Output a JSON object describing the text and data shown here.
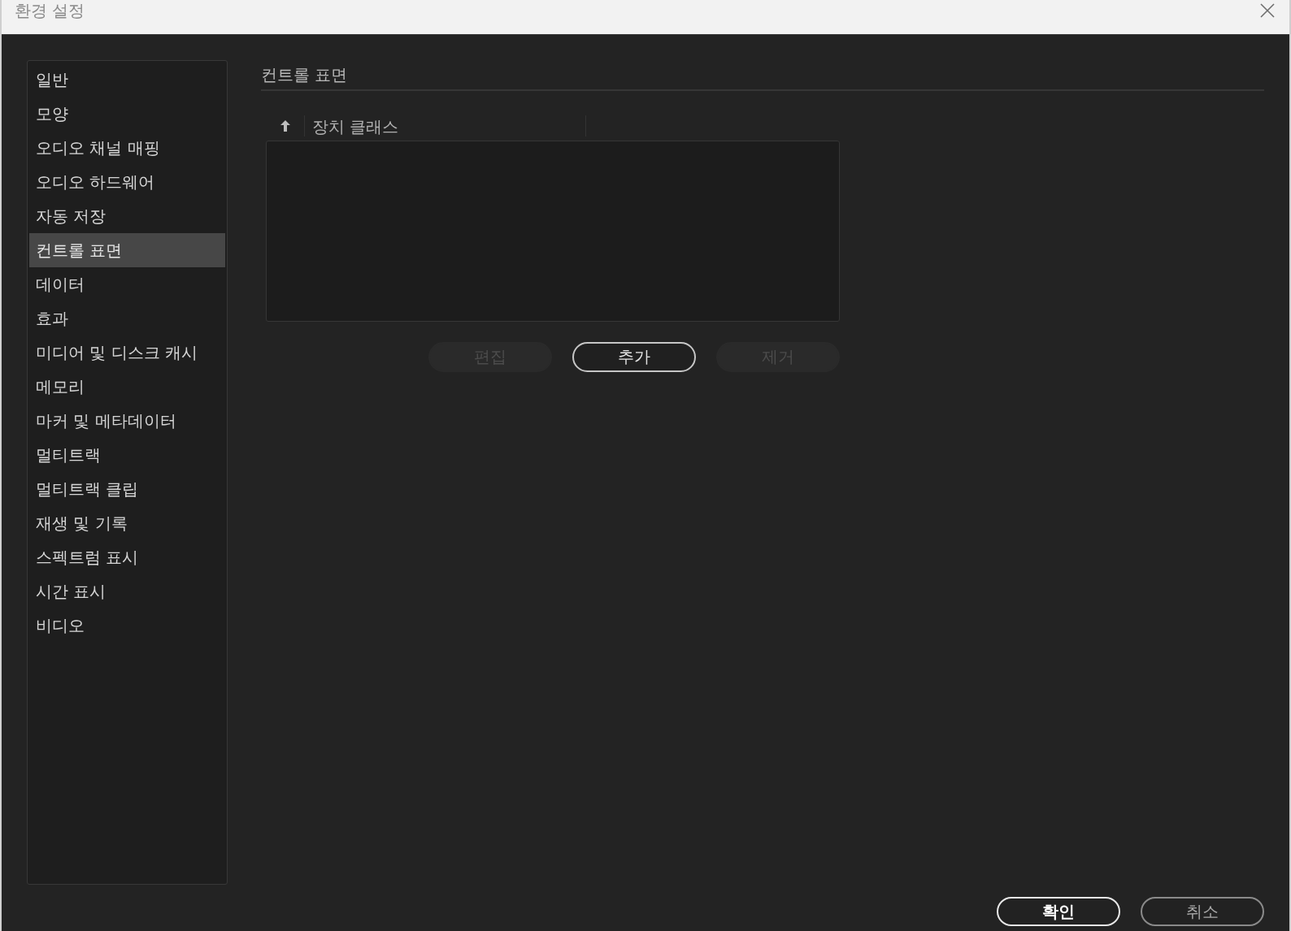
{
  "window": {
    "title": "환경 설정"
  },
  "sidebar": {
    "items": [
      {
        "label": "일반",
        "selected": false
      },
      {
        "label": "모양",
        "selected": false
      },
      {
        "label": "오디오 채널 매핑",
        "selected": false
      },
      {
        "label": "오디오 하드웨어",
        "selected": false
      },
      {
        "label": "자동 저장",
        "selected": false
      },
      {
        "label": "컨트롤 표면",
        "selected": true
      },
      {
        "label": "데이터",
        "selected": false
      },
      {
        "label": "효과",
        "selected": false
      },
      {
        "label": "미디어 및 디스크 캐시",
        "selected": false
      },
      {
        "label": "메모리",
        "selected": false
      },
      {
        "label": "마커 및 메타데이터",
        "selected": false
      },
      {
        "label": "멀티트랙",
        "selected": false
      },
      {
        "label": "멀티트랙 클립",
        "selected": false
      },
      {
        "label": "재생 및 기록",
        "selected": false
      },
      {
        "label": "스펙트럼 표시",
        "selected": false
      },
      {
        "label": "시간 표시",
        "selected": false
      },
      {
        "label": "비디오",
        "selected": false
      }
    ]
  },
  "panel": {
    "title": "컨트롤 표면",
    "table": {
      "columns": [
        {
          "label": "장치 클래스"
        }
      ]
    },
    "buttons": [
      {
        "label": "편집",
        "disabled": true
      },
      {
        "label": "추가",
        "disabled": false
      },
      {
        "label": "제거",
        "disabled": true
      }
    ]
  },
  "footer": {
    "buttons": [
      {
        "label": "확인",
        "default": true
      },
      {
        "label": "취소",
        "default": false
      }
    ]
  }
}
